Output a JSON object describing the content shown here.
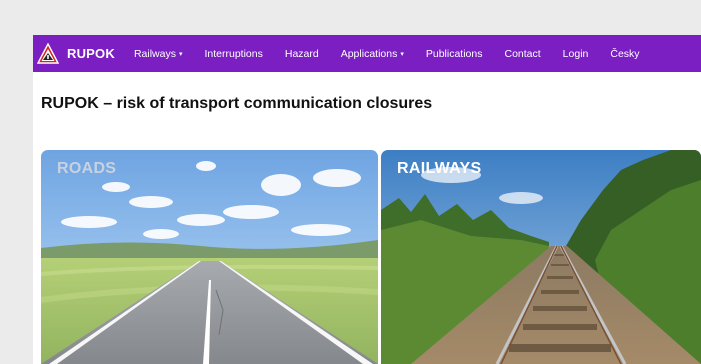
{
  "brand": {
    "name": "RUPOK"
  },
  "nav": {
    "items": [
      {
        "label": "Railways",
        "dropdown": true
      },
      {
        "label": "Interruptions",
        "dropdown": false
      },
      {
        "label": "Hazard",
        "dropdown": false
      },
      {
        "label": "Applications",
        "dropdown": true
      },
      {
        "label": "Publications",
        "dropdown": false
      },
      {
        "label": "Contact",
        "dropdown": false
      },
      {
        "label": "Login",
        "dropdown": false
      },
      {
        "label": "Česky",
        "dropdown": false
      }
    ],
    "caret": "▾"
  },
  "page": {
    "title": "RUPOK – risk of transport communication closures"
  },
  "tiles": {
    "roads": {
      "label": "ROADS"
    },
    "railways": {
      "label": "RAILWAYS"
    }
  },
  "colors": {
    "navbar": "#7b1fc3",
    "background": "#ebebeb",
    "content": "#ffffff"
  }
}
